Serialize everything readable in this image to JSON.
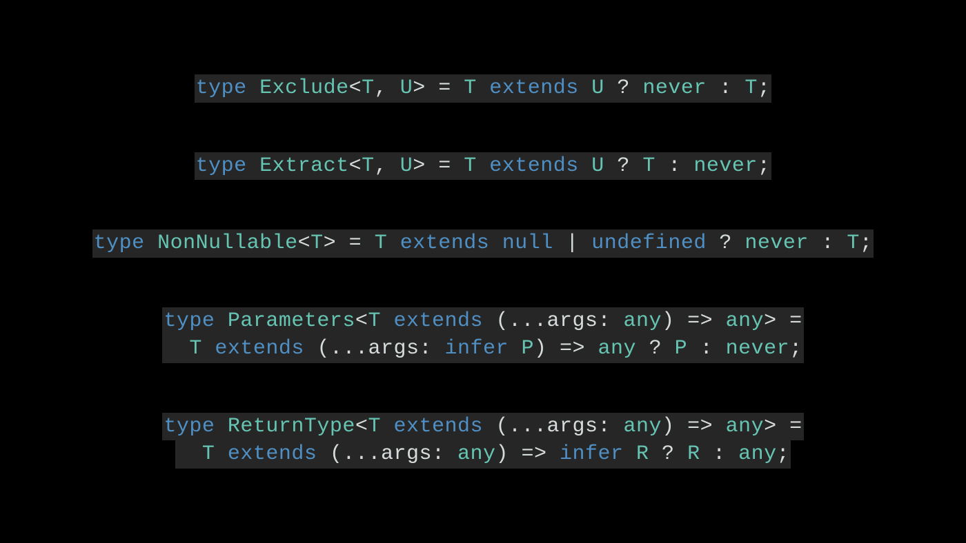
{
  "colors": {
    "background": "#000000",
    "codeBackground": "#262626",
    "keyword": "#4f8fc3",
    "typeName": "#66c4b2",
    "punctuation": "#d6dbdb",
    "identifier": "#d6dbdb"
  },
  "code": {
    "exclude": {
      "tokens": [
        {
          "t": "type ",
          "c": "kw"
        },
        {
          "t": "Exclude",
          "c": "tn"
        },
        {
          "t": "<",
          "c": "pn"
        },
        {
          "t": "T",
          "c": "tn"
        },
        {
          "t": ", ",
          "c": "pn"
        },
        {
          "t": "U",
          "c": "tn"
        },
        {
          "t": "> = ",
          "c": "pn"
        },
        {
          "t": "T",
          "c": "tn"
        },
        {
          "t": " ",
          "c": "pn"
        },
        {
          "t": "extends",
          "c": "kw"
        },
        {
          "t": " ",
          "c": "pn"
        },
        {
          "t": "U",
          "c": "tn"
        },
        {
          "t": " ? ",
          "c": "pn"
        },
        {
          "t": "never",
          "c": "tn"
        },
        {
          "t": " : ",
          "c": "pn"
        },
        {
          "t": "T",
          "c": "tn"
        },
        {
          "t": ";",
          "c": "pn"
        }
      ]
    },
    "extract": {
      "tokens": [
        {
          "t": "type ",
          "c": "kw"
        },
        {
          "t": "Extract",
          "c": "tn"
        },
        {
          "t": "<",
          "c": "pn"
        },
        {
          "t": "T",
          "c": "tn"
        },
        {
          "t": ", ",
          "c": "pn"
        },
        {
          "t": "U",
          "c": "tn"
        },
        {
          "t": "> = ",
          "c": "pn"
        },
        {
          "t": "T",
          "c": "tn"
        },
        {
          "t": " ",
          "c": "pn"
        },
        {
          "t": "extends",
          "c": "kw"
        },
        {
          "t": " ",
          "c": "pn"
        },
        {
          "t": "U",
          "c": "tn"
        },
        {
          "t": " ? ",
          "c": "pn"
        },
        {
          "t": "T",
          "c": "tn"
        },
        {
          "t": " : ",
          "c": "pn"
        },
        {
          "t": "never",
          "c": "tn"
        },
        {
          "t": ";",
          "c": "pn"
        }
      ]
    },
    "nonnullable": {
      "tokens": [
        {
          "t": "type ",
          "c": "kw"
        },
        {
          "t": "NonNullable",
          "c": "tn"
        },
        {
          "t": "<",
          "c": "pn"
        },
        {
          "t": "T",
          "c": "tn"
        },
        {
          "t": "> = ",
          "c": "pn"
        },
        {
          "t": "T",
          "c": "tn"
        },
        {
          "t": " ",
          "c": "pn"
        },
        {
          "t": "extends",
          "c": "kw"
        },
        {
          "t": " ",
          "c": "pn"
        },
        {
          "t": "null",
          "c": "kw"
        },
        {
          "t": " | ",
          "c": "pn"
        },
        {
          "t": "undefined",
          "c": "kw"
        },
        {
          "t": " ? ",
          "c": "pn"
        },
        {
          "t": "never",
          "c": "tn"
        },
        {
          "t": " : ",
          "c": "pn"
        },
        {
          "t": "T",
          "c": "tn"
        },
        {
          "t": ";",
          "c": "pn"
        }
      ]
    },
    "parameters": {
      "line1": [
        {
          "t": "type ",
          "c": "kw"
        },
        {
          "t": "Parameters",
          "c": "tn"
        },
        {
          "t": "<",
          "c": "pn"
        },
        {
          "t": "T",
          "c": "tn"
        },
        {
          "t": " ",
          "c": "pn"
        },
        {
          "t": "extends",
          "c": "kw"
        },
        {
          "t": " (...",
          "c": "pn"
        },
        {
          "t": "args",
          "c": "id"
        },
        {
          "t": ": ",
          "c": "pn"
        },
        {
          "t": "any",
          "c": "tn"
        },
        {
          "t": ") => ",
          "c": "pn"
        },
        {
          "t": "any",
          "c": "tn"
        },
        {
          "t": "> =",
          "c": "pn"
        }
      ],
      "line2": [
        {
          "t": "  ",
          "c": "pn"
        },
        {
          "t": "T",
          "c": "tn"
        },
        {
          "t": " ",
          "c": "pn"
        },
        {
          "t": "extends",
          "c": "kw"
        },
        {
          "t": " (...",
          "c": "pn"
        },
        {
          "t": "args",
          "c": "id"
        },
        {
          "t": ": ",
          "c": "pn"
        },
        {
          "t": "infer",
          "c": "kw"
        },
        {
          "t": " ",
          "c": "pn"
        },
        {
          "t": "P",
          "c": "tn"
        },
        {
          "t": ") => ",
          "c": "pn"
        },
        {
          "t": "any",
          "c": "tn"
        },
        {
          "t": " ? ",
          "c": "pn"
        },
        {
          "t": "P",
          "c": "tn"
        },
        {
          "t": " : ",
          "c": "pn"
        },
        {
          "t": "never",
          "c": "tn"
        },
        {
          "t": ";",
          "c": "pn"
        }
      ]
    },
    "returntype": {
      "line1": [
        {
          "t": "type ",
          "c": "kw"
        },
        {
          "t": "ReturnType",
          "c": "tn"
        },
        {
          "t": "<",
          "c": "pn"
        },
        {
          "t": "T",
          "c": "tn"
        },
        {
          "t": " ",
          "c": "pn"
        },
        {
          "t": "extends",
          "c": "kw"
        },
        {
          "t": " (...",
          "c": "pn"
        },
        {
          "t": "args",
          "c": "id"
        },
        {
          "t": ": ",
          "c": "pn"
        },
        {
          "t": "any",
          "c": "tn"
        },
        {
          "t": ") => ",
          "c": "pn"
        },
        {
          "t": "any",
          "c": "tn"
        },
        {
          "t": "> =",
          "c": "pn"
        }
      ],
      "line2": [
        {
          "t": "  ",
          "c": "pn"
        },
        {
          "t": "T",
          "c": "tn"
        },
        {
          "t": " ",
          "c": "pn"
        },
        {
          "t": "extends",
          "c": "kw"
        },
        {
          "t": " (...",
          "c": "pn"
        },
        {
          "t": "args",
          "c": "id"
        },
        {
          "t": ": ",
          "c": "pn"
        },
        {
          "t": "any",
          "c": "tn"
        },
        {
          "t": ") => ",
          "c": "pn"
        },
        {
          "t": "infer",
          "c": "kw"
        },
        {
          "t": " ",
          "c": "pn"
        },
        {
          "t": "R",
          "c": "tn"
        },
        {
          "t": " ? ",
          "c": "pn"
        },
        {
          "t": "R",
          "c": "tn"
        },
        {
          "t": " : ",
          "c": "pn"
        },
        {
          "t": "any",
          "c": "tn"
        },
        {
          "t": ";",
          "c": "pn"
        }
      ]
    }
  }
}
